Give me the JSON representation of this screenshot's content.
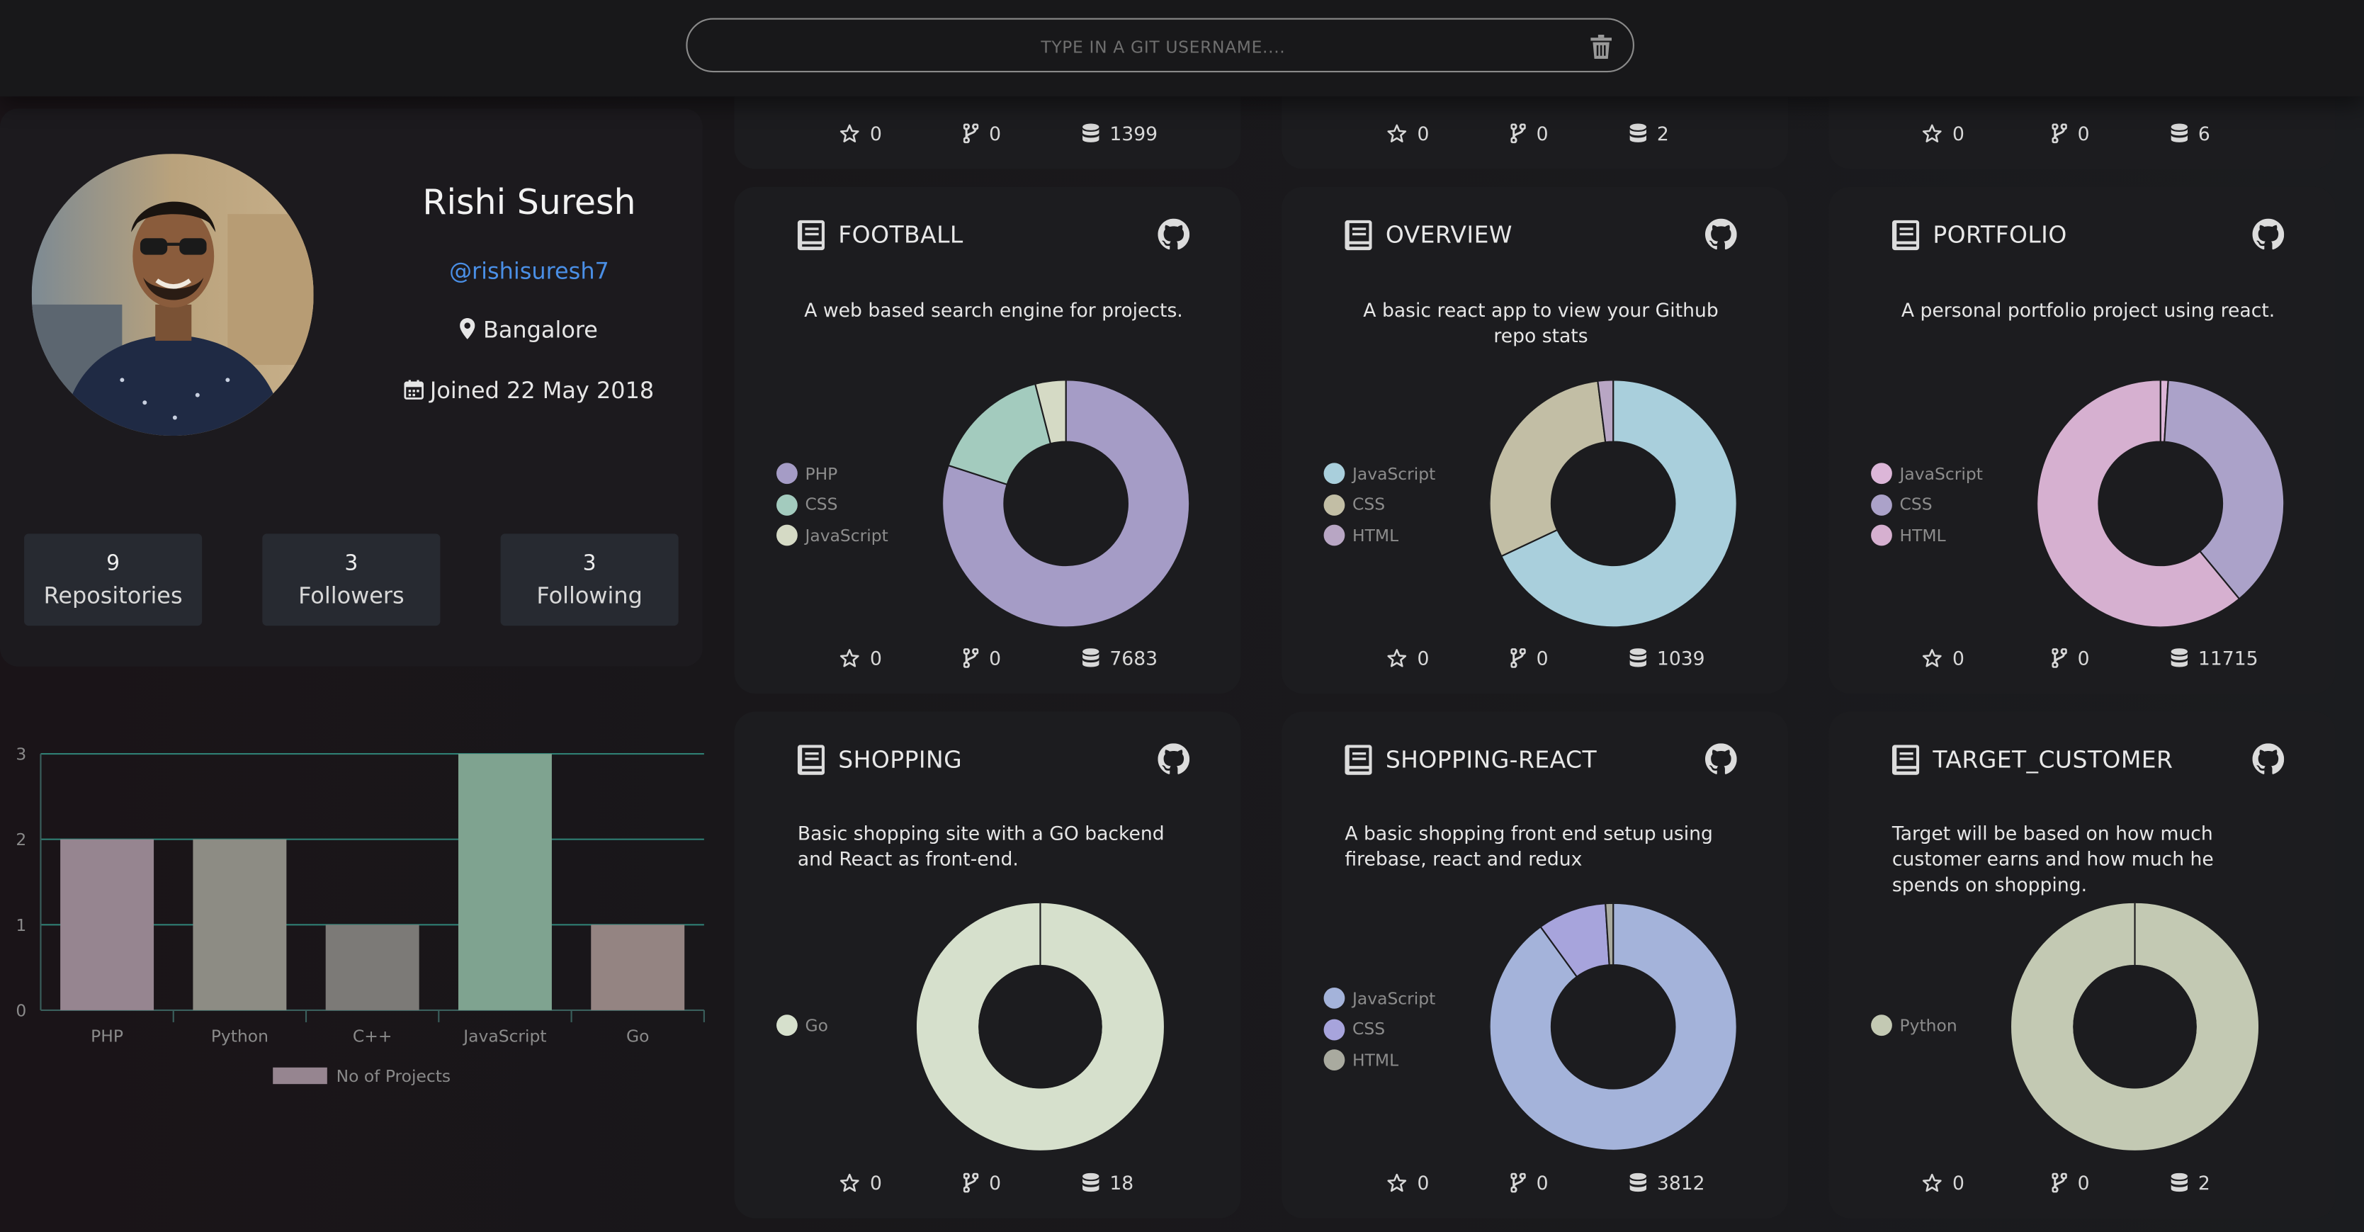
{
  "search": {
    "placeholder": "TYPE IN A GIT USERNAME...."
  },
  "profile": {
    "name": "Rishi Suresh",
    "handle": "@rishisuresh7",
    "location": "Bangalore",
    "joined": "Joined 22 May 2018",
    "stats": [
      {
        "value": "9",
        "label": "Repositories"
      },
      {
        "value": "3",
        "label": "Followers"
      },
      {
        "value": "3",
        "label": "Following"
      }
    ]
  },
  "chart_data": {
    "type": "bar",
    "categories": [
      "PHP",
      "Python",
      "C++",
      "JavaScript",
      "Go"
    ],
    "series": [
      {
        "name": "No of Projects",
        "values": [
          2,
          2,
          1,
          3,
          1
        ]
      }
    ],
    "colors": [
      "#968590",
      "#8d8c84",
      "#7c7a77",
      "#7fa390",
      "#948482"
    ],
    "ylim": [
      0,
      3
    ],
    "yticks": [
      "0",
      "1",
      "2",
      "3"
    ],
    "legend": "bottom",
    "grid": true
  },
  "top_partial": [
    {
      "stars": "0",
      "forks": "0",
      "size": "1399"
    },
    {
      "stars": "0",
      "forks": "0",
      "size": "2"
    },
    {
      "stars": "0",
      "forks": "0",
      "size": "6"
    }
  ],
  "repos": [
    {
      "title": "FOOTBALL",
      "description": "A web based search engine for projects.",
      "languages": [
        {
          "name": "PHP",
          "share": 0.8,
          "color": "#a59cc6"
        },
        {
          "name": "CSS",
          "share": 0.16,
          "color": "#a3cbbe"
        },
        {
          "name": "JavaScript",
          "share": 0.04,
          "color": "#d5dac5"
        }
      ],
      "stars": "0",
      "forks": "0",
      "size": "7683"
    },
    {
      "title": "OVERVIEW",
      "description": "A basic react app to view your Github repo stats",
      "languages": [
        {
          "name": "JavaScript",
          "share": 0.68,
          "color": "#a9cfdc"
        },
        {
          "name": "CSS",
          "share": 0.3,
          "color": "#c2bea5"
        },
        {
          "name": "HTML",
          "share": 0.02,
          "color": "#b8a6c4"
        }
      ],
      "stars": "0",
      "forks": "0",
      "size": "1039"
    },
    {
      "title": "PORTFOLIO",
      "description": "A personal portfolio project using react.",
      "languages": [
        {
          "name": "JavaScript",
          "share": 0.01,
          "color": "#dcb6d8"
        },
        {
          "name": "CSS",
          "share": 0.38,
          "color": "#aba2c9"
        },
        {
          "name": "HTML",
          "share": 0.61,
          "color": "#d6b0d0"
        }
      ],
      "stars": "0",
      "forks": "0",
      "size": "11715"
    },
    {
      "title": "SHOPPING",
      "description": "Basic shopping site with a GO backend and React as front-end.",
      "languages": [
        {
          "name": "Go",
          "share": 1.0,
          "color": "#d6e0cc"
        }
      ],
      "stars": "0",
      "forks": "0",
      "size": "18"
    },
    {
      "title": "SHOPPING-REACT",
      "description": "A basic shopping front end setup using firebase, react and redux",
      "languages": [
        {
          "name": "JavaScript",
          "share": 0.9,
          "color": "#a4b3da"
        },
        {
          "name": "CSS",
          "share": 0.09,
          "color": "#a7a4dc"
        },
        {
          "name": "HTML",
          "share": 0.01,
          "color": "#a9aa9f"
        }
      ],
      "stars": "0",
      "forks": "0",
      "size": "3812"
    },
    {
      "title": "TARGET_CUSTOMER",
      "description": "Target will be based on how much customer earns and how much he spends on shopping.",
      "languages": [
        {
          "name": "Python",
          "share": 1.0,
          "color": "#c3c9b3"
        }
      ],
      "stars": "0",
      "forks": "0",
      "size": "2"
    }
  ]
}
